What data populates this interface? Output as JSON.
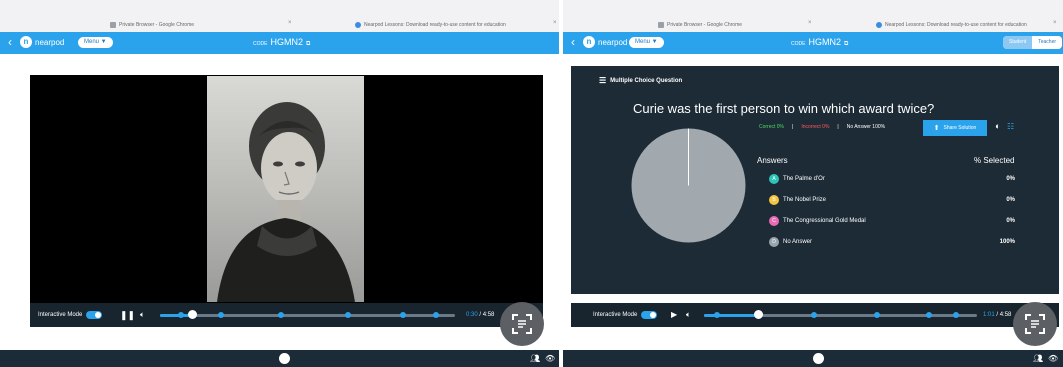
{
  "browser": {
    "left_tabs": [
      {
        "title": "Private Browser - Google Chrome"
      },
      {
        "title": "Nearpod Lessons: Download ready-to-use content for education"
      }
    ],
    "right_tabs": [
      {
        "title": "Private Browser - Google Chrome"
      },
      {
        "title": "Nearpod Lessons: Download ready-to-use content for education"
      }
    ]
  },
  "header": {
    "logo": "nearpod",
    "menu_label": "Menu ▼",
    "code_label": "CODE",
    "code": "HGMN2",
    "mode_student": "Student",
    "mode_teacher": "Teacher"
  },
  "video_player": {
    "interactive_mode_label": "Interactive Mode",
    "current_time": "0:30",
    "separator": "/",
    "duration": "4:58",
    "progress": 0.11
  },
  "question": {
    "type_label": "Multiple Choice Question",
    "text": "Curie was the first person to win which award twice?",
    "stats": {
      "correct": "Correct 0%",
      "incorrect": "Incorrect 0%",
      "no_answer": "No Answer 100%"
    },
    "share_label": "Share Solution",
    "answers_header": "Answers",
    "selected_header": "% Selected",
    "answers": [
      {
        "letter": "A",
        "text": "The Palme d'Or",
        "pct": "0%",
        "color": "#2ec4b6"
      },
      {
        "letter": "B",
        "text": "The Nobel Prize",
        "pct": "0%",
        "color": "#f5c542"
      },
      {
        "letter": "C",
        "text": "The Congressional Gold Medal",
        "pct": "0%",
        "color": "#e86bb5"
      },
      {
        "letter": "D",
        "text": "No Answer",
        "pct": "100%",
        "color": "#9aa4ad"
      }
    ]
  },
  "question_player": {
    "interactive_mode_label": "Interactive Mode",
    "current_time": "1:01",
    "separator": "/",
    "duration": "4:58",
    "progress": 0.2
  },
  "colors": {
    "nearpod_blue": "#2ba3ec",
    "dark_slide": "#1d2b36",
    "pie_grey": "#a1a9ae"
  }
}
